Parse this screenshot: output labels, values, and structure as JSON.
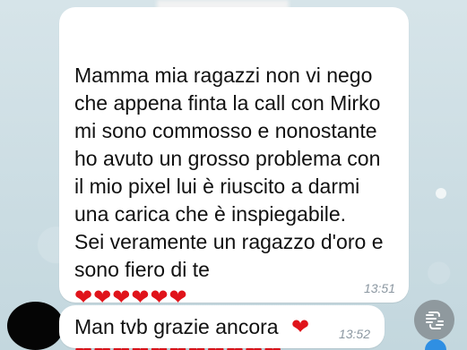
{
  "colors": {
    "chat_background": "#c7dbe3",
    "bubble": "#ffffff",
    "heart": "#e0141b",
    "timestamp": "#8b97a1",
    "fab": "#8f999e",
    "badge": "#2f8fe3"
  },
  "messages": [
    {
      "text": "Mamma mia ragazzi non vi nego\nche appena finta la call con Mirko\nmi sono commosso e nonostante\nho avuto un grosso problema con\nil mio pixel lui è riuscito a darmi\nuna carica che è inspiegabile.\nSei veramente un ragazzo d'oro e\nsono fiero di te",
      "hearts_line_one": "❤❤❤❤❤❤",
      "hearts_line_two": "❤❤❤❤❤❤❤❤❤❤❤",
      "time": "13:51"
    },
    {
      "text": "Man tvb grazie ancora",
      "heart": "❤",
      "time": "13:52"
    }
  ],
  "icons": {
    "translate": "translate-icon",
    "heart": "heart-icon",
    "avatar": "avatar-icon"
  }
}
